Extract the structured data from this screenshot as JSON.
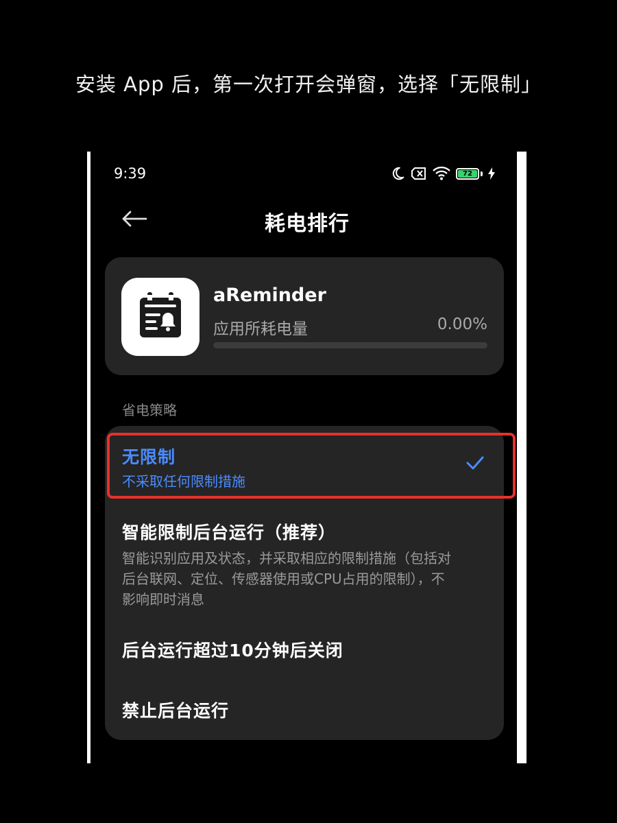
{
  "caption": "安装 App 后，第一次打开会弹窗，选择「无限制」",
  "status_bar": {
    "time": "9:39",
    "battery_level": "72",
    "icons": [
      "moon-icon",
      "sim-off-icon",
      "wifi-icon",
      "battery-icon",
      "charging-icon"
    ]
  },
  "nav": {
    "back_icon": "arrow-left-icon",
    "title": "耗电排行"
  },
  "app": {
    "name": "aReminder",
    "usage_label": "应用所耗电量",
    "usage_value": "0.00%",
    "usage_fraction": 0.0,
    "icon": "calendar-bell-icon"
  },
  "section_label": "省电策略",
  "options": [
    {
      "title": "无限制",
      "desc": "不采取任何限制措施",
      "selected": true
    },
    {
      "title": "智能限制后台运行（推荐）",
      "desc": "智能识别应用及状态，并采取相应的限制措施（包括对后台联网、定位、传感器使用或CPU占用的限制），不影响即时消息",
      "selected": false
    },
    {
      "title": "后台运行超过10分钟后关闭",
      "desc": "",
      "selected": false
    },
    {
      "title": "禁止后台运行",
      "desc": "",
      "selected": false
    }
  ],
  "colors": {
    "accent": "#4a8cff",
    "highlight": "#e8312a",
    "card": "#252525"
  }
}
